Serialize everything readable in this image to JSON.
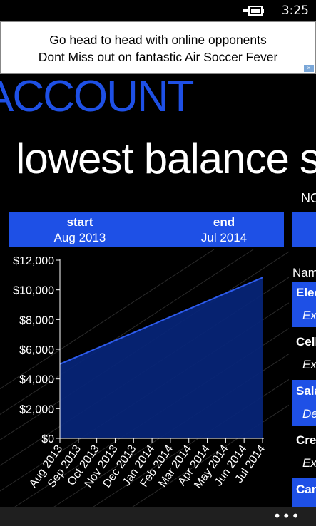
{
  "status_bar": {
    "time": "3:25",
    "battery_icon": "battery-charging-icon"
  },
  "ad": {
    "line1": "Go head to head with online opponents",
    "line2": "Dont Miss out on fantastic Air Soccer Fever",
    "close_glyph": "×"
  },
  "app": {
    "title": "ACCOUNT"
  },
  "pivot": {
    "current": "lowest balance",
    "next": "s"
  },
  "range": {
    "start_label": "start",
    "start_value": "Aug 2013",
    "end_label": "end",
    "end_value": "Jul 2014"
  },
  "peek": {
    "subtitle": "NO",
    "name_header": "Nam",
    "items": [
      {
        "title": "Elec",
        "sub": "Exp",
        "highlight": true
      },
      {
        "title": "Cell",
        "sub": "Exp",
        "highlight": false
      },
      {
        "title": "Sala",
        "sub": "Dep",
        "highlight": true
      },
      {
        "title": "Cre",
        "sub": "Exp",
        "highlight": false
      },
      {
        "title": "Car",
        "sub": "",
        "highlight": true
      }
    ]
  },
  "app_bar": {
    "more_glyph": "•••"
  },
  "colors": {
    "accent": "#1e50e6",
    "area_fill": "#07257a",
    "area_line": "#2d5cf0"
  },
  "chart_data": {
    "type": "area",
    "categories": [
      "Aug 2013",
      "Sep 2013",
      "Oct 2013",
      "Nov 2013",
      "Dec 2013",
      "Jan 2014",
      "Feb 2014",
      "Mar 2014",
      "Apr 2014",
      "May 2014",
      "Jun 2014",
      "Jul 2014"
    ],
    "values": [
      5000,
      5530,
      6060,
      6590,
      7120,
      7650,
      8180,
      8710,
      9240,
      9770,
      10300,
      10830
    ],
    "yticks": [
      "$0",
      "$2,000",
      "$4,000",
      "$6,000",
      "$8,000",
      "$10,000",
      "$12,000"
    ],
    "ylim": [
      0,
      12000
    ],
    "title": "",
    "xlabel": "",
    "ylabel": ""
  }
}
